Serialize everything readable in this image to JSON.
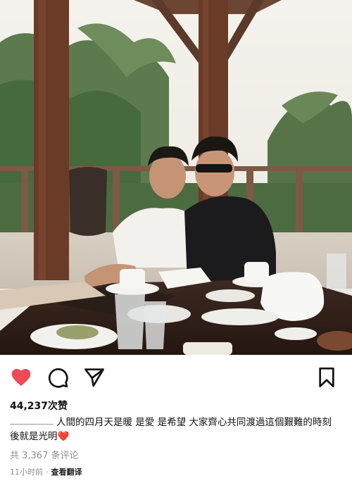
{
  "post": {
    "photo_alt": "Two men seated at a dining table in an open-air pavilion with palm trees",
    "actions": {
      "like_icon": "heart-filled-icon",
      "comment_icon": "comment-bubble-icon",
      "share_icon": "send-paper-plane-icon",
      "save_icon": "bookmark-icon",
      "like_color": "#ed4956"
    },
    "likes": "44,237次赞",
    "caption": {
      "username": "",
      "text": "人間的四月天是暖 是愛 是希望 大家齊心共同渡過這個艱難的時刻後就是光明",
      "emoji": "❤️"
    },
    "comments_link": "共 3,367 条评论",
    "time": "11小时前",
    "separator": "·",
    "see_translation": "查看翻译"
  }
}
